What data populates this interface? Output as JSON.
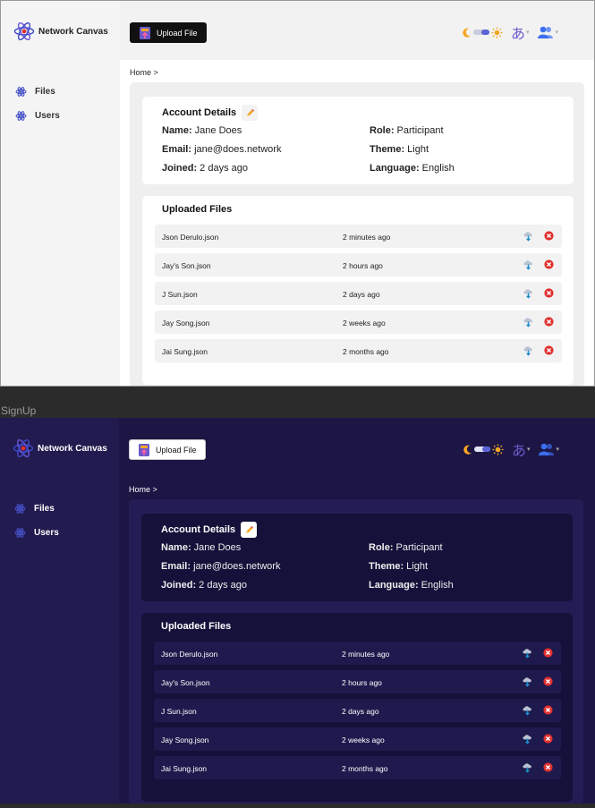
{
  "brand": {
    "name": "Network Canvas"
  },
  "sidebar": {
    "items": [
      {
        "label": "Files",
        "icon": "atom-icon"
      },
      {
        "label": "Users",
        "icon": "atom-icon"
      }
    ]
  },
  "toolbar": {
    "upload_label": "Upload File",
    "language_glyph": "あ",
    "caret": "▾"
  },
  "breadcrumb": "Home >",
  "account": {
    "title": "Account Details",
    "fields": [
      {
        "label": "Name:",
        "value": " Jane Does"
      },
      {
        "label": "Email:",
        "value": " jane@does.network"
      },
      {
        "label": "Joined:",
        "value": " 2 days ago"
      },
      {
        "label": "Role:",
        "value": " Participant"
      },
      {
        "label": "Theme:",
        "value": " Light"
      },
      {
        "label": "Language:",
        "value": " English"
      }
    ]
  },
  "uploaded": {
    "title": "Uploaded Files",
    "files": [
      {
        "name": "Json Derulo.json",
        "time": "2 minutes ago"
      },
      {
        "name": "Jay's Son.json",
        "time": "2 hours ago"
      },
      {
        "name": "J Sun.json",
        "time": "2 days ago"
      },
      {
        "name": "Jay Song.json",
        "time": "2 weeks ago"
      },
      {
        "name": "Jai Sung.json",
        "time": "2 months ago"
      }
    ]
  },
  "frame_caption": "SignUp",
  "colors": {
    "accent": "#5a63d6",
    "delete": "#e0302f",
    "sun": "#f5a623",
    "dark_bg": "#1d1645",
    "dark_sidebar": "#221b4f"
  }
}
